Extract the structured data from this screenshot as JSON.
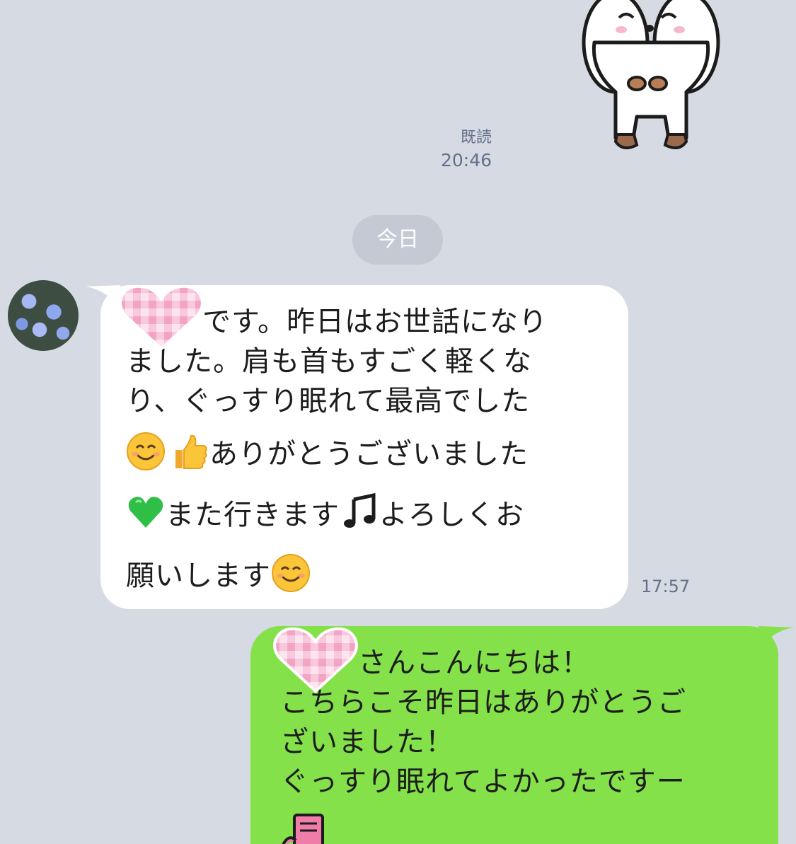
{
  "read_receipt": {
    "label": "既読",
    "time": "20:46"
  },
  "date_divider": "今日",
  "incoming": {
    "time": "17:57",
    "lines": [
      "です。昨日はお世話になり",
      "ました。肩も首もすごく軽くな",
      "り、ぐっすり眠れて最高でした"
    ],
    "line4": "ありがとうございました",
    "line5a": "また行きます",
    "line5b": "よろしくお",
    "line6": "願いします"
  },
  "outgoing": {
    "lines": [
      "さんこんにちは！",
      "こちらこそ昨日はありがとうご",
      "ざいました！",
      "ぐっすり眠れてよかったですー"
    ]
  },
  "icons": {
    "sticker": "bowing-bear-sticker",
    "heart": "pink-gingham-heart",
    "smile": "smiling-face-emoji",
    "thumbs": "thumbs-up-emoji",
    "green_heart": "green-heart-emoji",
    "note": "music-note-emoji"
  },
  "colors": {
    "background": "#d5dae3",
    "incoming_bubble": "#ffffff",
    "outgoing_bubble": "#84e14a",
    "meta_text": "#65718a"
  }
}
